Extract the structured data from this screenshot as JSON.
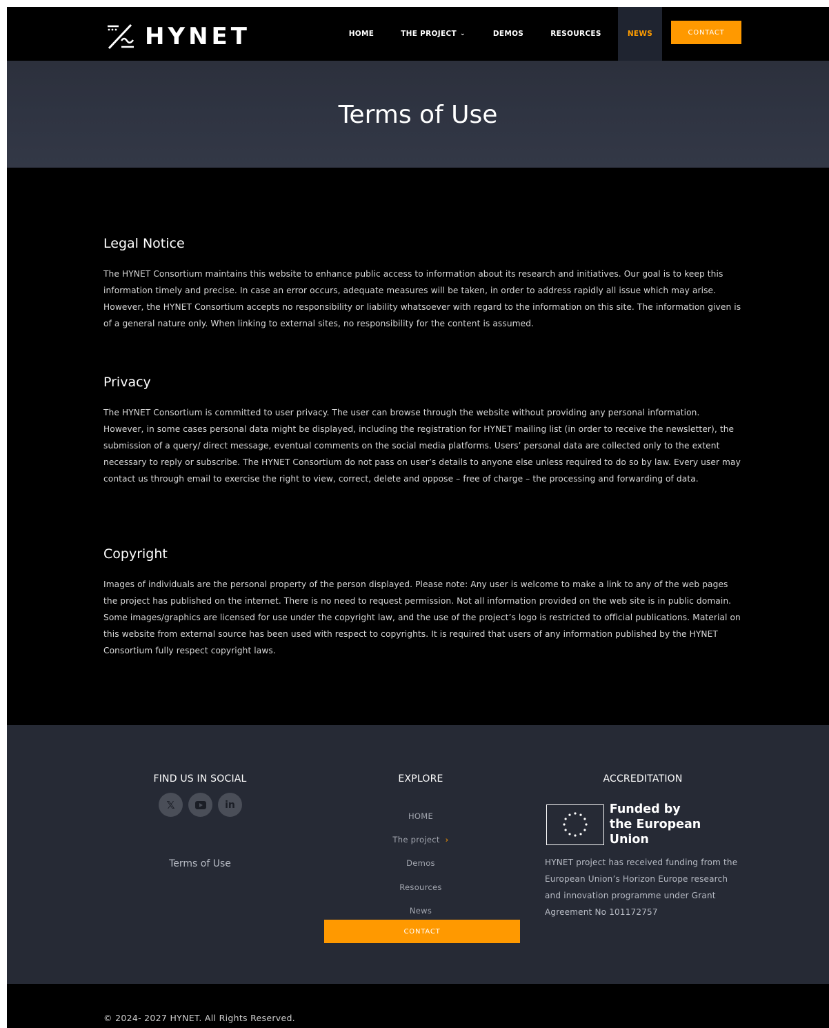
{
  "brand": {
    "name": "HYNET"
  },
  "nav": {
    "items": [
      {
        "label": "HOME"
      },
      {
        "label": "THE PROJECT"
      },
      {
        "label": "DEMOS"
      },
      {
        "label": "RESOURCES"
      },
      {
        "label": "NEWS"
      }
    ],
    "contact_label": "CONTACT",
    "active_item": "NEWS"
  },
  "hero": {
    "title": "Terms of Use"
  },
  "sections": {
    "legal": {
      "heading": "Legal Notice",
      "body": "The HYNET Consortium maintains this website to enhance public access to information about its research and initiatives. Our goal is to keep this information timely and precise. In case an error occurs, adequate measures will be taken, in order to address rapidly all issue which may arise. However, the HYNET Consortium accepts no responsibility or liability whatsoever with regard to the information on this site. The information given is of a general nature only. When linking to external sites, no responsibility for the content is assumed."
    },
    "privacy": {
      "heading": "Privacy",
      "body": "The HYNET Consortium is committed to user privacy. The user can browse through the website without providing any personal information. However, in some cases personal data might be displayed, including the registration for HYNET mailing list (in order to receive the newsletter), the submission of a query/ direct message, eventual comments on the social media platforms. Users’ personal data are collected only to the extent necessary to reply or subscribe. The HYNET Consortium do not pass on user’s details to anyone else unless required to do so by law. Every user may contact us through email to exercise the right to view, correct, delete and oppose – free of charge – the processing and forwarding of data."
    },
    "copyright": {
      "heading": "Copyright",
      "body": "Images of individuals are the personal property of the person displayed. Please note: Any user is welcome to make a link to any of the web pages the project has published on the internet. There is no need to request permission. Not all information provided on the web site is in public domain. Some images/graphics are licensed for use under the copyright law, and the use of the project’s logo is restricted to official publications. Material on this website from external source has been used with respect to copyrights. It is required that users of any information published by the HYNET Consortium fully respect copyright laws."
    }
  },
  "footer": {
    "social": {
      "title": "FIND US IN SOCIAL",
      "icons": [
        "x-icon",
        "youtube-icon",
        "linkedin-icon"
      ],
      "terms_label": "Terms of Use"
    },
    "explore": {
      "title": "EXPLORE",
      "links": [
        "HOME",
        "The project",
        "Demos",
        "Resources",
        "News"
      ],
      "contact_label": "CONTACT"
    },
    "accreditation": {
      "title": "ACCREDITATION",
      "eu_line1": "Funded by",
      "eu_line2": "the European Union",
      "description": "HYNET project has received funding from the European Union’s Horizon Europe research and innovation programme under Grant Agreement No 101172757"
    }
  },
  "bottom": {
    "copyright": "© 2024- 2027 HYNET. All Rights Reserved."
  },
  "colors": {
    "accent": "#ff9900",
    "header_bg": "#000000",
    "hero_bg": "#2f3442",
    "footer_bg": "#262a35"
  }
}
